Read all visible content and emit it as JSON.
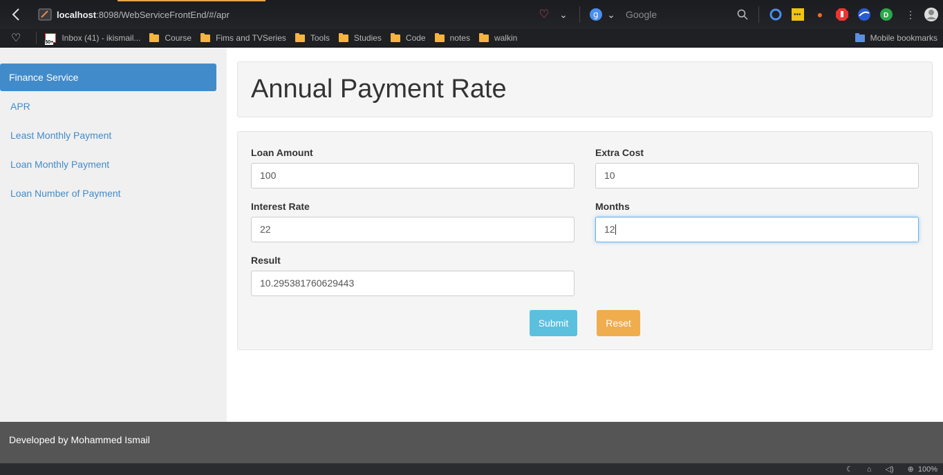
{
  "browser": {
    "url_host": "localhost",
    "url_rest": ":8098/WebServiceFrontEnd/#/apr",
    "search_placeholder": "Google",
    "zoom": "100%"
  },
  "bookmarks": [
    {
      "label": "Inbox (41) - ikismail...",
      "icon": "gmail-icon"
    },
    {
      "label": "Course",
      "icon": "folder-icon"
    },
    {
      "label": "Fims and TVSeries",
      "icon": "folder-icon"
    },
    {
      "label": "Tools",
      "icon": "folder-icon"
    },
    {
      "label": "Studies",
      "icon": "folder-icon"
    },
    {
      "label": "Code",
      "icon": "folder-icon"
    },
    {
      "label": "notes",
      "icon": "folder-icon"
    },
    {
      "label": "walkin",
      "icon": "folder-icon"
    }
  ],
  "mobile_bookmarks": "Mobile bookmarks",
  "sidebar": {
    "active": "Finance Service",
    "items": [
      "APR",
      "Least Monthly Payment",
      "Loan Monthly Payment",
      "Loan Number of Payment"
    ]
  },
  "main": {
    "title": "Annual Payment Rate",
    "fields": {
      "loan_amount": {
        "label": "Loan Amount",
        "value": "100"
      },
      "extra_cost": {
        "label": "Extra Cost",
        "value": "10"
      },
      "interest_rate": {
        "label": "Interest Rate",
        "value": "22"
      },
      "months": {
        "label": "Months",
        "value": "12"
      },
      "result": {
        "label": "Result",
        "value": "10.295381760629443"
      }
    },
    "submit_label": "Submit",
    "reset_label": "Reset"
  },
  "footer": {
    "text": "Developed by Mohammed Ismail"
  },
  "colors": {
    "primary": "#428bca",
    "info": "#5bc0de",
    "warning": "#f0ad4e",
    "footer": "#555555"
  }
}
